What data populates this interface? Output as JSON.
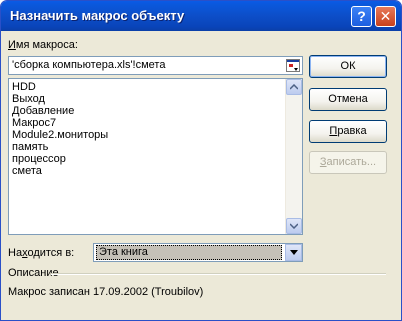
{
  "window": {
    "title": "Назначить макрос объекту",
    "help_icon": "?",
    "close_icon": "✕"
  },
  "macro_name": {
    "label_pre": "",
    "label_key": "И",
    "label_post": "мя макроса:",
    "value": "'сборка компьютера.xls'!смета",
    "icon": "collapse-dialog-icon"
  },
  "macro_list": {
    "items": [
      "HDD",
      "Выход",
      "Добавление",
      "Макрос7",
      "Module2.мониторы",
      "память",
      "процессор",
      "смета"
    ]
  },
  "buttons": {
    "ok": "ОК",
    "cancel": "Отмена",
    "edit_pre": "",
    "edit_key": "П",
    "edit_post": "равка",
    "record_pre": "",
    "record_key": "З",
    "record_post": "аписать..."
  },
  "location": {
    "label_pre": "На",
    "label_key": "х",
    "label_post": "одится в:",
    "value": "Эта книга"
  },
  "description": {
    "label": "Описание",
    "text": "Макрос записан 17.09.2002 (Troubilov)"
  },
  "colors": {
    "title_bar": "#0a4ec8",
    "dialog_bg": "#ece9d8",
    "close_button": "#d2542f"
  }
}
